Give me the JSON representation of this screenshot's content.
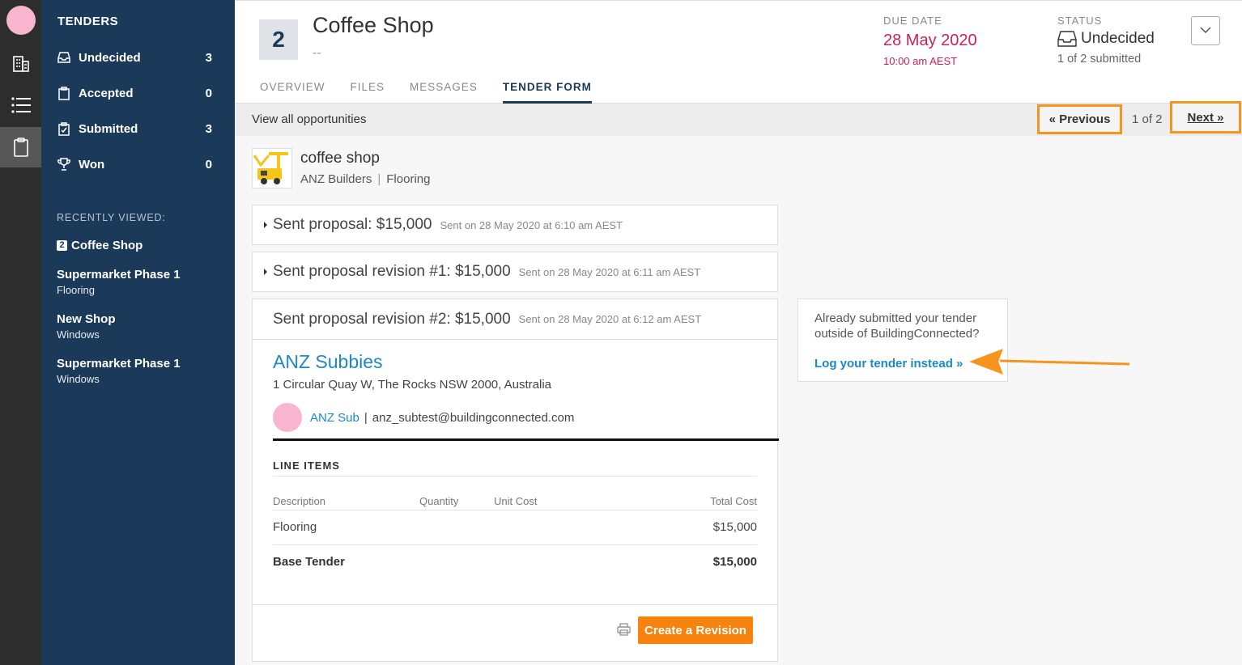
{
  "sidebar": {
    "title": "TENDERS",
    "items": [
      {
        "label": "Undecided",
        "count": "3",
        "icon": "inbox-icon"
      },
      {
        "label": "Accepted",
        "count": "0",
        "icon": "clipboard-icon"
      },
      {
        "label": "Submitted",
        "count": "3",
        "icon": "clipboard-check-icon"
      },
      {
        "label": "Won",
        "count": "0",
        "icon": "trophy-icon"
      }
    ],
    "recent_title": "RECENTLY VIEWED:",
    "recent": [
      {
        "badge": "2",
        "title": "Coffee Shop",
        "sub": ""
      },
      {
        "title": "Supermarket Phase 1",
        "sub": "Flooring"
      },
      {
        "title": "New Shop",
        "sub": "Windows"
      },
      {
        "title": "Supermarket Phase 1",
        "sub": "Windows"
      }
    ]
  },
  "header": {
    "number": "2",
    "title": "Coffee Shop",
    "subtitle": "--",
    "tabs": [
      "OVERVIEW",
      "FILES",
      "MESSAGES",
      "TENDER FORM"
    ],
    "active_tab": "TENDER FORM",
    "due_label": "DUE DATE",
    "due_date": "28 May 2020",
    "due_time": "10:00 am AEST",
    "status_label": "STATUS",
    "status_value": "Undecided",
    "status_sub": "1 of 2 submitted"
  },
  "nav": {
    "view_all": "View all opportunities",
    "prev": "« Previous",
    "page": "1 of 2",
    "next": "Next »"
  },
  "project": {
    "name": "coffee shop",
    "company": "ANZ Builders",
    "trade": "Flooring"
  },
  "proposals": [
    {
      "title": "Sent proposal: $15,000",
      "sent": "Sent on 28 May 2020 at 6:10 am AEST"
    },
    {
      "title": "Sent proposal revision #1: $15,000",
      "sent": "Sent on 28 May 2020 at 6:11 am AEST"
    },
    {
      "title": "Sent proposal revision #2: $15,000",
      "sent": "Sent on 28 May 2020 at 6:12 am AEST"
    }
  ],
  "proposal_detail": {
    "company": "ANZ Subbies",
    "address": "1 Circular Quay W, The Rocks NSW 2000, Australia",
    "contact_name": "ANZ Sub",
    "contact_email": "anz_subtest@buildingconnected.com",
    "line_items_title": "LINE ITEMS",
    "columns": [
      "Description",
      "Quantity",
      "Unit Cost",
      "Total Cost"
    ],
    "rows": [
      {
        "description": "Flooring",
        "quantity": "",
        "unit_cost": "",
        "total": "$15,000"
      }
    ],
    "base_label": "Base Tender",
    "base_total": "$15,000",
    "create_revision": "Create a Revision"
  },
  "side_card": {
    "question": "Already submitted your tender outside of BuildingConnected?",
    "link": "Log your tender instead »"
  },
  "colors": {
    "sidebar_bg": "#1b3a5a",
    "accent_orange": "#f7820d",
    "due_red": "#c91f5a",
    "link_blue": "#1d87c9"
  }
}
